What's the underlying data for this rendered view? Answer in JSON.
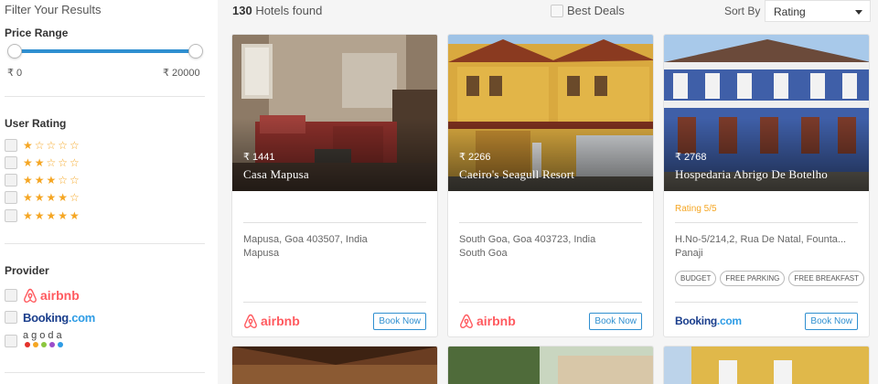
{
  "sidebar": {
    "title": "Filter Your Results",
    "price_range": {
      "heading": "Price Range",
      "min_label": "₹ 0",
      "max_label": "₹ 20000",
      "selected_min_fraction": 0,
      "selected_max_fraction": 1
    },
    "user_rating": {
      "heading": "User Rating",
      "options": [
        {
          "stars": "★☆☆☆☆"
        },
        {
          "stars": "★★☆☆☆"
        },
        {
          "stars": "★★★☆☆"
        },
        {
          "stars": "★★★★☆"
        },
        {
          "stars": "★★★★★"
        }
      ]
    },
    "provider": {
      "heading": "Provider",
      "options": [
        {
          "name": "airbnb",
          "icon": "airbnb-logo-icon"
        },
        {
          "name_main": "Booking",
          "name_suffix": ".com",
          "icon": "booking-logo"
        },
        {
          "name": "agoda",
          "icon": "agoda-logo"
        }
      ]
    }
  },
  "main": {
    "results_count": "130",
    "results_label": " Hotels found",
    "best_deals_label": "Best Deals",
    "sort_by_label": "Sort By",
    "sort_selected": "Rating",
    "hotels": [
      {
        "price": "₹ 1441",
        "name": "Casa Mapusa",
        "rating": "",
        "address_line1": "Mapusa, Goa 403507, India",
        "address_line2": "Mapusa",
        "tags": [],
        "provider": "airbnb",
        "book_label": "Book Now"
      },
      {
        "price": "₹ 2266",
        "name": "Caeiro's Seagull Resort",
        "rating": "",
        "address_line1": "South Goa, Goa 403723, India",
        "address_line2": "South Goa",
        "tags": [],
        "provider": "airbnb",
        "book_label": "Book Now"
      },
      {
        "price": "₹ 2768",
        "name": "Hospedaria Abrigo De Botelho",
        "rating": "Rating 5/5",
        "address_line1": "H.No-5/214,2, Rua De Natal, Founta...",
        "address_line2": "Panaji",
        "tags": [
          "BUDGET",
          "FREE PARKING",
          "FREE BREAKFAST"
        ],
        "provider_main": "Booking",
        "provider_suffix": ".com",
        "book_label": "Book Now"
      }
    ]
  },
  "colors": {
    "accent": "#2f8fd0",
    "star": "#f5a623",
    "airbnb": "#ff5a5f",
    "booking_dark": "#1a3e8c",
    "booking_light": "#2e9ce5"
  }
}
